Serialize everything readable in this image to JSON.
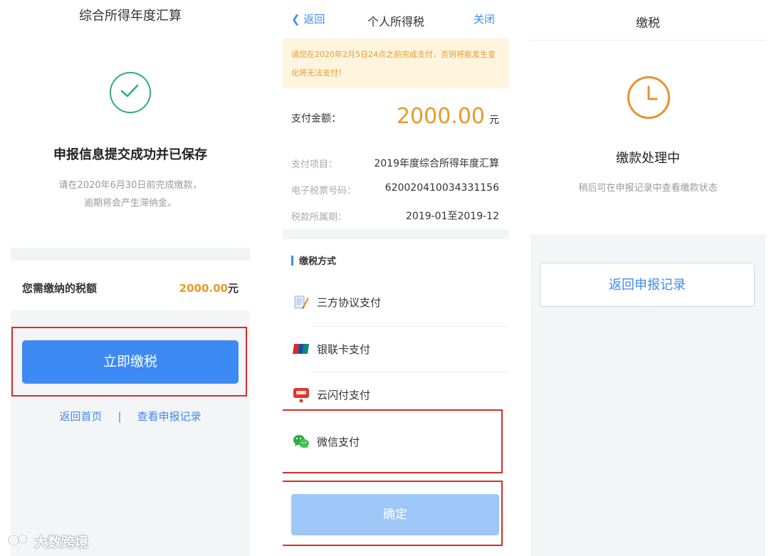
{
  "panel1": {
    "title": "综合所得年度汇算",
    "heading": "申报信息提交成功并已保存",
    "subtext_line1": "请在2020年6月30日前完成缴款，",
    "subtext_line2": "逾期将会产生滞纳金。",
    "amount_label": "您需缴纳的税额",
    "amount_value": "2000.00",
    "amount_unit": "元",
    "pay_button": "立即缴税",
    "link_home": "返回首页",
    "link_separator": "|",
    "link_records": "查看申报记录"
  },
  "panel2": {
    "back": "返回",
    "title": "个人所得税",
    "close": "关闭",
    "notice_line1": "请您在2020年2月5日24点之前完成支付，否则将能发生变",
    "notice_line2": "化将无法支付！",
    "pay_amount_label": "支付金额：",
    "pay_amount_value": "2000.00",
    "pay_amount_unit": "元",
    "rows": [
      {
        "label": "支付项目：",
        "value": "2019年度综合所得年度汇算"
      },
      {
        "label": "电子税票号码：",
        "value": "620020410034331156"
      },
      {
        "label": "税款所属期：",
        "value": "2019-01至2019-12"
      }
    ],
    "section_title": "缴税方式",
    "methods": [
      {
        "label": "三方协议支付",
        "icon": "pencil-doc-icon"
      },
      {
        "label": "银联卡支付",
        "icon": "unionpay-icon"
      },
      {
        "label": "云闪付支付",
        "icon": "quickpass-icon"
      },
      {
        "label": "微信支付",
        "icon": "wechat-icon"
      }
    ],
    "confirm_button": "确定"
  },
  "panel3": {
    "title": "缴税",
    "heading": "缴款处理中",
    "subtext": "稍后可在申报记录中查看缴款状态",
    "button": "返回申报记录"
  },
  "watermark": "大数跨境",
  "colors": {
    "primary_blue": "#3d8bf2",
    "orange": "#e89a2a",
    "success_green": "#2fae72",
    "highlight_red": "#d32f2f"
  }
}
